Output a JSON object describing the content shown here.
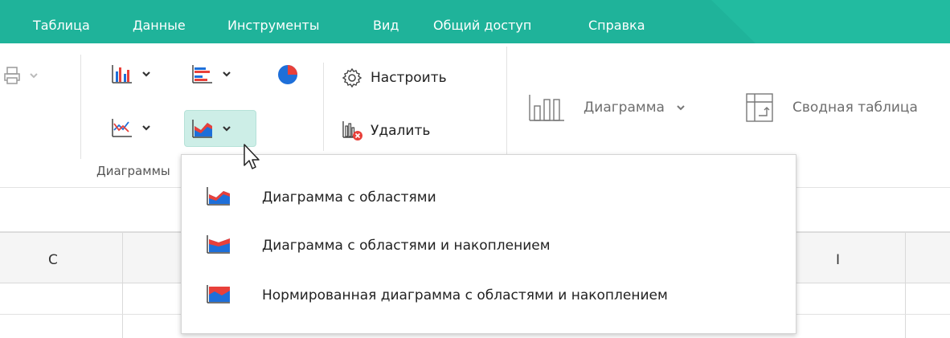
{
  "menubar": {
    "items": [
      "Таблица",
      "Данные",
      "Инструменты",
      "Вид",
      "Общий доступ",
      "Справка"
    ]
  },
  "ribbon": {
    "settings_label": "Настроить",
    "delete_label": "Удалить",
    "chart_label": "Диаграмма",
    "pivot_label": "Сводная таблица",
    "group_label": "Диаграммы"
  },
  "sheet": {
    "columns": [
      "C",
      "I"
    ]
  },
  "dropdown": {
    "items": [
      {
        "label": "Диаграмма с областями",
        "icon": "area-chart-icon"
      },
      {
        "label": "Диаграмма с областями и накоплением",
        "icon": "stacked-area-chart-icon"
      },
      {
        "label": "Нормированная диаграмма с областями и накоплением",
        "icon": "percent-stacked-area-chart-icon"
      }
    ]
  },
  "colors": {
    "accent": "#1fb39a",
    "blue": "#1e6fd9",
    "red": "#e8403a",
    "hover": "#cdeee7"
  }
}
